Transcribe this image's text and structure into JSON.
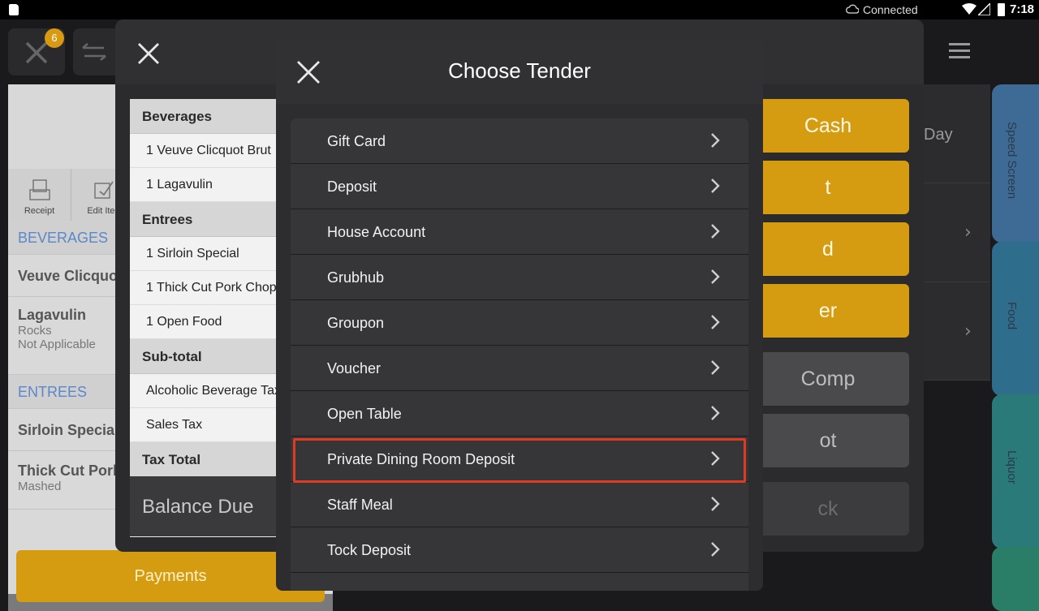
{
  "status_bar": {
    "connection": "Connected",
    "time": "7:18"
  },
  "background": {
    "order_badge": "6",
    "toolbar": {
      "receipt_label": "Receipt",
      "edit_item_label": "Edit Iten"
    },
    "order_rows": [
      {
        "kind": "category",
        "text": "BEVERAGES"
      },
      {
        "kind": "item",
        "text": "Veuve Clicquo"
      },
      {
        "kind": "item",
        "text": "Lagavulin",
        "sub1": "Rocks",
        "sub2": "Not Applicable"
      },
      {
        "kind": "category",
        "text": "ENTREES"
      },
      {
        "kind": "item",
        "text": "Sirloin Specia"
      },
      {
        "kind": "item",
        "text": "Thick Cut Pork",
        "sub1": "Mashed"
      }
    ],
    "payments_label": "Payments",
    "right_day_label": "Day",
    "side_tabs": [
      "Speed Screen",
      "Food",
      "Liquor"
    ]
  },
  "payment_modal": {
    "check_sections": [
      {
        "title": "Beverages",
        "lines": [
          "1 Veuve Clicquot Brut",
          "1 Lagavulin"
        ]
      },
      {
        "title": "Entrees",
        "lines": [
          "1 Sirloin Special",
          "1 Thick Cut Pork Chop",
          "1 Open Food"
        ]
      },
      {
        "title": "Sub-total",
        "lines": [
          "Alcoholic Beverage Tax",
          "Sales Tax"
        ]
      },
      {
        "title": "Tax Total",
        "lines": []
      }
    ],
    "balance_due_label": "Balance Due",
    "tender_buttons": [
      {
        "label": "Cash",
        "style": "gold"
      },
      {
        "label": "t",
        "style": "gold"
      },
      {
        "label": "d",
        "style": "gold"
      },
      {
        "label": "er",
        "style": "gold"
      },
      {
        "label": "Comp",
        "style": "gray"
      },
      {
        "label": "ot",
        "style": "gray"
      },
      {
        "label": "ck",
        "style": "dark"
      }
    ]
  },
  "dialog": {
    "title": "Choose Tender",
    "items": [
      "Gift Card",
      "Deposit",
      "House Account",
      "Grubhub",
      "Groupon",
      "Voucher",
      "Open Table",
      "Private Dining Room Deposit",
      "Staff Meal",
      "Tock Deposit"
    ],
    "highlighted_item": "Private Dining Room Deposit"
  },
  "colors": {
    "accent_gold": "#d59c12",
    "highlight_red": "#e03a22",
    "dialog_bg": "#2d2d2f",
    "list_row": "#363638"
  }
}
